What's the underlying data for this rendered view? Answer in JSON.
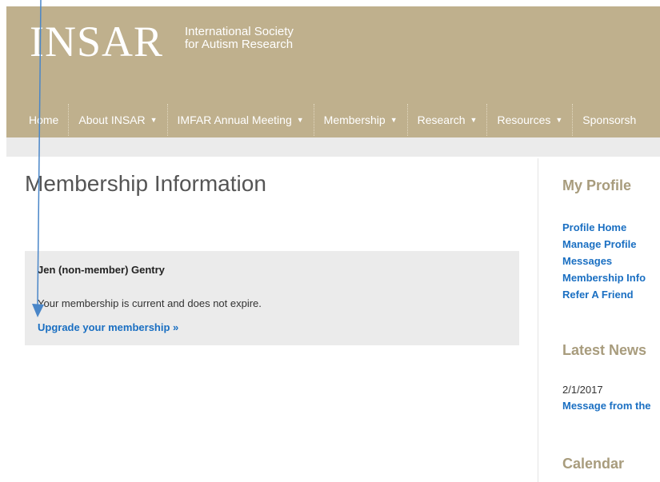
{
  "header": {
    "logo_text": "INSAR",
    "tagline_line1": "International Society",
    "tagline_line2": "for Autism Research",
    "nav": [
      {
        "label": "Home",
        "has_caret": false
      },
      {
        "label": "About INSAR",
        "has_caret": true
      },
      {
        "label": "IMFAR Annual Meeting",
        "has_caret": true
      },
      {
        "label": "Membership",
        "has_caret": true
      },
      {
        "label": "Research",
        "has_caret": true
      },
      {
        "label": "Resources",
        "has_caret": true
      },
      {
        "label": "Sponsorsh",
        "has_caret": false
      }
    ]
  },
  "main": {
    "title": "Membership Information",
    "member": {
      "name": "Jen (non-member) Gentry",
      "status": "Your membership is current and does not expire.",
      "upgrade_label": "Upgrade your membership »"
    }
  },
  "sidebar": {
    "profile_heading": "My Profile",
    "profile_links": [
      "Profile Home",
      "Manage Profile",
      "Messages",
      "Membership Info",
      "Refer A Friend"
    ],
    "news_heading": "Latest News",
    "news_date": "2/1/2017",
    "news_title": "Message from the",
    "calendar_heading": "Calendar"
  },
  "icons": {
    "caret": "caret-down-icon",
    "annotation": "arrow-icon"
  },
  "colors": {
    "header_bg": "#bfb08d",
    "link": "#1a6fc2",
    "sidebar_heading": "#a89c7d",
    "box_bg": "#ebebeb"
  }
}
